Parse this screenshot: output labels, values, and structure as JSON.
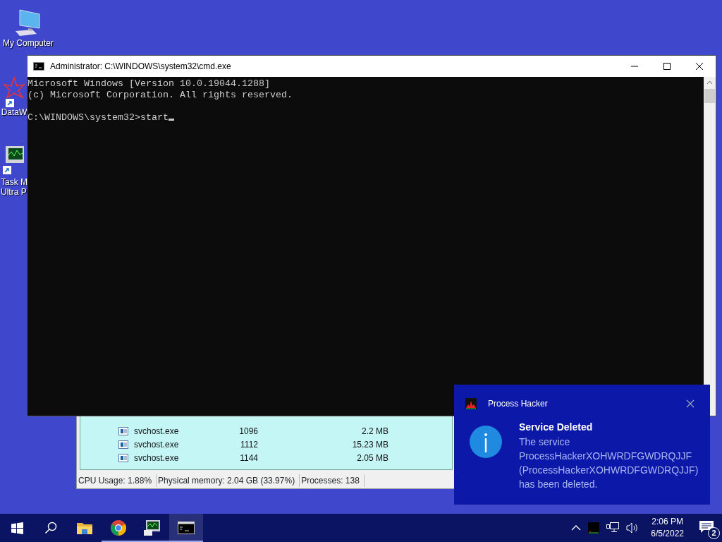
{
  "desktop_icons": [
    {
      "label": "My Computer",
      "kind": "computer"
    },
    {
      "label": "DataW",
      "kind": "data"
    },
    {
      "label": "Task M\nUltra P",
      "kind": "taskmgr"
    }
  ],
  "process_window": {
    "rows": [
      {
        "name": "svchost.exe",
        "pid": "1096",
        "memory": "2.2 MB"
      },
      {
        "name": "svchost.exe",
        "pid": "1112",
        "memory": "15.23 MB"
      },
      {
        "name": "svchost.exe",
        "pid": "1144",
        "memory": "2.05 MB"
      }
    ],
    "status_bar": [
      "CPU Usage: 1.88%",
      "Physical memory: 2.04 GB (33.97%)",
      "Processes: 138"
    ]
  },
  "console_window": {
    "title": "Administrator: C:\\WINDOWS\\system32\\cmd.exe",
    "lines": [
      "Microsoft Windows [Version 10.0.19044.1288]",
      "(c) Microsoft Corporation. All rights reserved."
    ],
    "prompt": "C:\\WINDOWS\\system32>start"
  },
  "notification": {
    "app": "Process Hacker",
    "title": "Service Deleted",
    "body": "The service ProcessHackerXOHWRDFGWDRQJJF (ProcessHackerXOHWRDFGWDRQJJF) has been deleted."
  },
  "taskbar": {
    "items": [
      {
        "kind": "start",
        "running": false,
        "selected": false
      },
      {
        "kind": "search",
        "running": false,
        "selected": false
      },
      {
        "kind": "folder",
        "running": false,
        "selected": false
      },
      {
        "kind": "browser",
        "running": true,
        "selected": false
      },
      {
        "kind": "taskmgr",
        "running": true,
        "selected": false
      },
      {
        "kind": "console",
        "running": true,
        "selected": true
      }
    ],
    "time": "2:06 PM",
    "date": "6/5/2022",
    "notification_count": "2"
  }
}
